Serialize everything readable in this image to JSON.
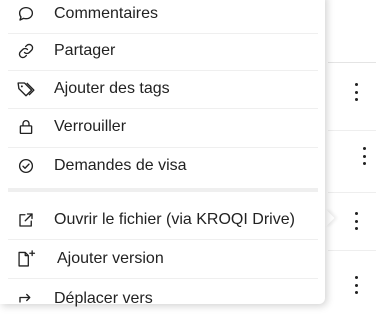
{
  "menu": {
    "items": [
      {
        "label": "Commentaires",
        "icon": "comment-icon"
      },
      {
        "label": "Partager",
        "icon": "link-icon"
      },
      {
        "label": "Ajouter des tags",
        "icon": "tag-icon"
      },
      {
        "label": "Verrouiller",
        "icon": "lock-icon"
      },
      {
        "label": "Demandes de visa",
        "icon": "check-circle-icon"
      },
      {
        "label": "Ouvrir le fichier (via KROQI Drive)",
        "icon": "external-link-icon"
      },
      {
        "label": "Ajouter version",
        "icon": "file-plus-icon"
      },
      {
        "label": "Déplacer vers",
        "icon": "move-icon"
      }
    ]
  },
  "colors": {
    "text": "#222222",
    "separator": "#efefef",
    "background": "#ffffff"
  }
}
